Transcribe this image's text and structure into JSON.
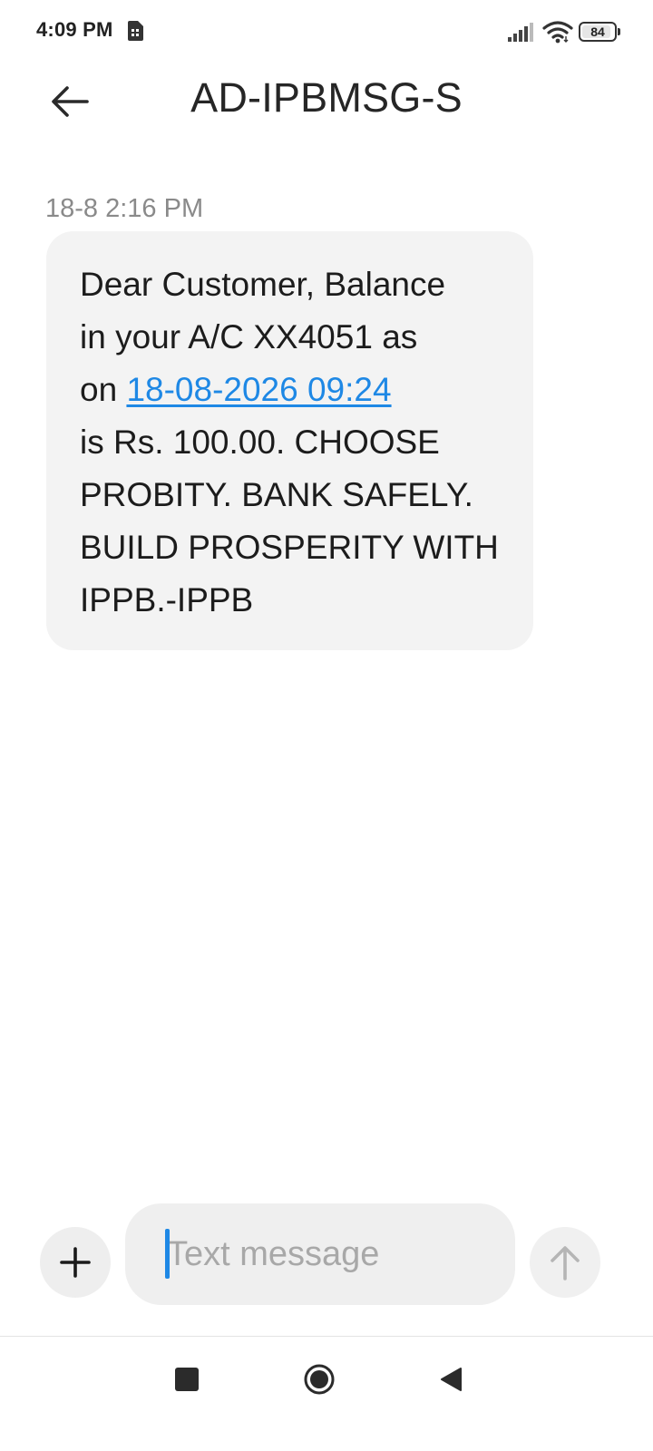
{
  "status_bar": {
    "time": "4:09 PM",
    "battery_level": "84",
    "icons": [
      "sim-card-icon",
      "signal-icon",
      "wifi-icon",
      "battery-icon"
    ]
  },
  "header": {
    "title": "AD-IPBMSG-S",
    "back_icon": "arrow-left-icon"
  },
  "conversation": {
    "messages": [
      {
        "timestamp": "18-8 2:16 PM",
        "lines": {
          "l1": "Dear Customer, Balance",
          "l2": "in your A/C XX4051 as",
          "l3_prefix": "on ",
          "l3_link": "18-08-2026 09:24",
          "l4": "is Rs. 100.00. CHOOSE",
          "l5": "PROBITY. BANK SAFELY.",
          "l6": "BUILD PROSPERITY WITH",
          "l7": "IPPB.-IPPB"
        }
      }
    ]
  },
  "compose": {
    "placeholder": "Text message",
    "attach_icon": "plus-icon",
    "send_icon": "arrow-up-icon"
  },
  "nav": {
    "icons": [
      "square-recents-icon",
      "circle-home-icon",
      "triangle-back-icon"
    ]
  },
  "colors": {
    "link": "#1e88e5",
    "bubble": "#f3f3f3",
    "timestamp": "#8a8a8a"
  }
}
